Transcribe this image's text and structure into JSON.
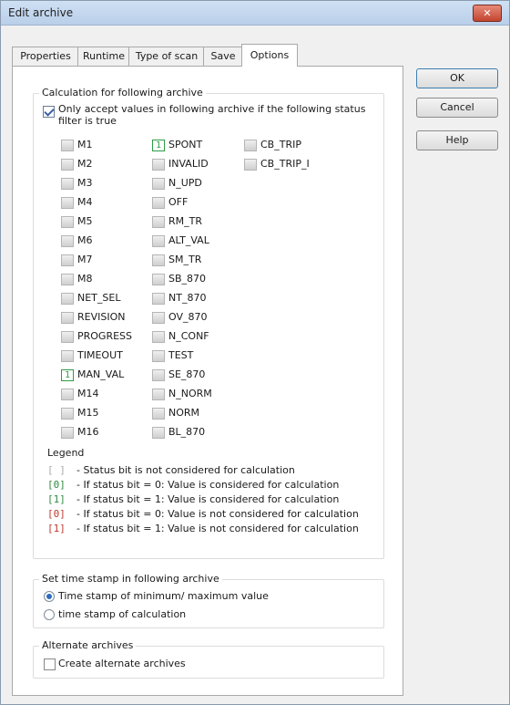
{
  "window": {
    "title": "Edit archive",
    "close_label": "✕"
  },
  "tabs": [
    "Properties",
    "Runtime",
    "Type of scan",
    "Save",
    "Options"
  ],
  "buttons": {
    "ok": "OK",
    "cancel": "Cancel",
    "help": "Help"
  },
  "calc_group": {
    "title": "Calculation for following archive",
    "only_accept_line1": "Only accept values in following archive if the following status",
    "only_accept_line2": "filter is true",
    "only_accept_checked": true
  },
  "status_columns": [
    [
      {
        "label": "M1",
        "state": ""
      },
      {
        "label": "M2",
        "state": ""
      },
      {
        "label": "M3",
        "state": ""
      },
      {
        "label": "M4",
        "state": ""
      },
      {
        "label": "M5",
        "state": ""
      },
      {
        "label": "M6",
        "state": ""
      },
      {
        "label": "M7",
        "state": ""
      },
      {
        "label": "M8",
        "state": ""
      },
      {
        "label": "NET_SEL",
        "state": ""
      },
      {
        "label": "REVISION",
        "state": ""
      },
      {
        "label": "PROGRESS",
        "state": ""
      },
      {
        "label": "TIMEOUT",
        "state": ""
      },
      {
        "label": "MAN_VAL",
        "state": "1"
      },
      {
        "label": "M14",
        "state": ""
      },
      {
        "label": "M15",
        "state": ""
      },
      {
        "label": "M16",
        "state": ""
      }
    ],
    [
      {
        "label": "SPONT",
        "state": "1"
      },
      {
        "label": "INVALID",
        "state": ""
      },
      {
        "label": "N_UPD",
        "state": ""
      },
      {
        "label": "OFF",
        "state": ""
      },
      {
        "label": "RM_TR",
        "state": ""
      },
      {
        "label": "ALT_VAL",
        "state": ""
      },
      {
        "label": "SM_TR",
        "state": ""
      },
      {
        "label": "SB_870",
        "state": ""
      },
      {
        "label": "NT_870",
        "state": ""
      },
      {
        "label": "OV_870",
        "state": ""
      },
      {
        "label": "N_CONF",
        "state": ""
      },
      {
        "label": "TEST",
        "state": ""
      },
      {
        "label": "SE_870",
        "state": ""
      },
      {
        "label": "N_NORM",
        "state": ""
      },
      {
        "label": "NORM",
        "state": ""
      },
      {
        "label": "BL_870",
        "state": ""
      }
    ],
    [
      {
        "label": "CB_TRIP",
        "state": ""
      },
      {
        "label": "CB_TRIP_I",
        "state": ""
      }
    ]
  ],
  "legend": {
    "title": "Legend",
    "items": [
      {
        "code": "[ ]",
        "color": "#a8a8a8",
        "text": "- Status bit is not considered for calculation"
      },
      {
        "code": "[0]",
        "color": "#2e8b3e",
        "text": "- If status bit = 0: Value is considered for calculation"
      },
      {
        "code": "[1]",
        "color": "#2e8b3e",
        "text": "- If status bit = 1: Value is considered for calculation"
      },
      {
        "code": "[0]",
        "color": "#c0392b",
        "text": "- If status bit = 0: Value is not considered for calculation"
      },
      {
        "code": "[1]",
        "color": "#c0392b",
        "text": "- If status bit = 1: Value is not considered for calculation"
      }
    ]
  },
  "timestamp_group": {
    "title": "Set time stamp in following archive",
    "option1": "Time stamp of minimum/ maximum value",
    "option2": "time stamp of calculation",
    "selected": 1
  },
  "alternate_group": {
    "title": "Alternate archives",
    "checkbox_label": "Create alternate archives",
    "checked": false
  }
}
